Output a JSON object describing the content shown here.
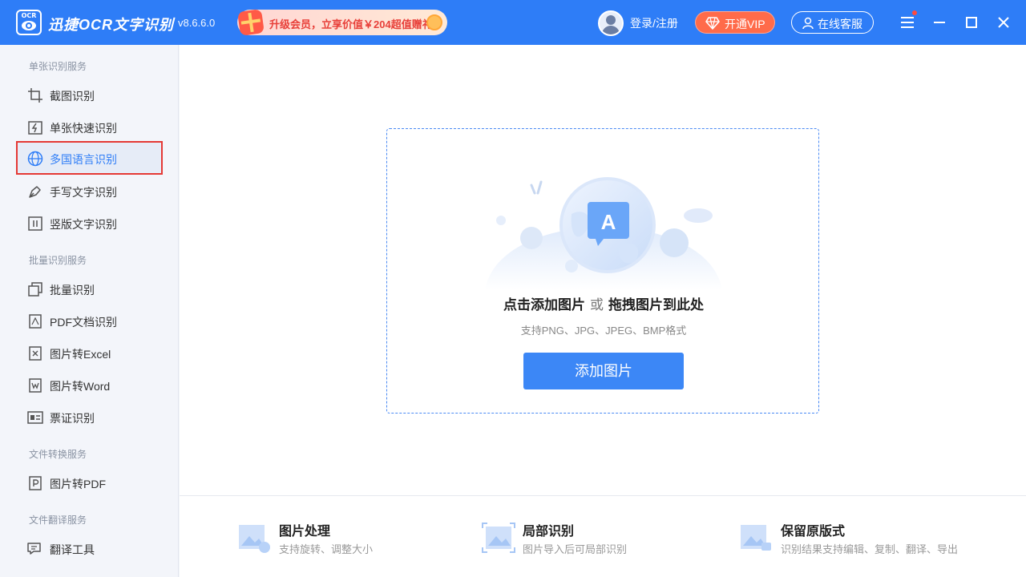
{
  "app": {
    "logo_text": "OCR",
    "name": "迅捷OCR文字识别",
    "version": "v8.6.6.0"
  },
  "promo": {
    "text": "升级会员，立享价值￥204超值赠礼"
  },
  "header": {
    "login_label": "登录/注册",
    "vip_label": "开通VIP",
    "service_label": "在线客服"
  },
  "sidebar": {
    "sections": [
      {
        "title": "单张识别服务",
        "items": [
          {
            "label": "截图识别",
            "icon": "crop-icon"
          },
          {
            "label": "单张快速识别",
            "icon": "image-lightning-icon"
          },
          {
            "label": "多国语言识别",
            "icon": "globe-icon",
            "active": true
          },
          {
            "label": "手写文字识别",
            "icon": "pen-icon"
          },
          {
            "label": "竖版文字识别",
            "icon": "vertical-text-icon"
          }
        ]
      },
      {
        "title": "批量识别服务",
        "items": [
          {
            "label": "批量识别",
            "icon": "stack-icon"
          },
          {
            "label": "PDF文档识别",
            "icon": "pdf-icon"
          },
          {
            "label": "图片转Excel",
            "icon": "excel-icon"
          },
          {
            "label": "图片转Word",
            "icon": "word-icon"
          },
          {
            "label": "票证识别",
            "icon": "id-card-icon"
          }
        ]
      },
      {
        "title": "文件转换服务",
        "items": [
          {
            "label": "图片转PDF",
            "icon": "p-file-icon"
          }
        ]
      },
      {
        "title": "文件翻译服务",
        "items": [
          {
            "label": "翻译工具",
            "icon": "translate-icon"
          }
        ]
      }
    ]
  },
  "dropzone": {
    "illustration_letter": "A",
    "title_part1": "点击添加图片",
    "title_or": "或",
    "title_part2": "拖拽图片到此处",
    "subtitle": "支持PNG、JPG、JPEG、BMP格式",
    "button_label": "添加图片"
  },
  "features": [
    {
      "title": "图片处理",
      "desc": "支持旋转、调整大小"
    },
    {
      "title": "局部识别",
      "desc": "图片导入后可局部识别"
    },
    {
      "title": "保留原版式",
      "desc": "识别结果支持编辑、复制、翻译、导出"
    }
  ],
  "colors": {
    "brand": "#2e7df7",
    "vip": "#ff6b4a",
    "active_border": "#e53935"
  }
}
